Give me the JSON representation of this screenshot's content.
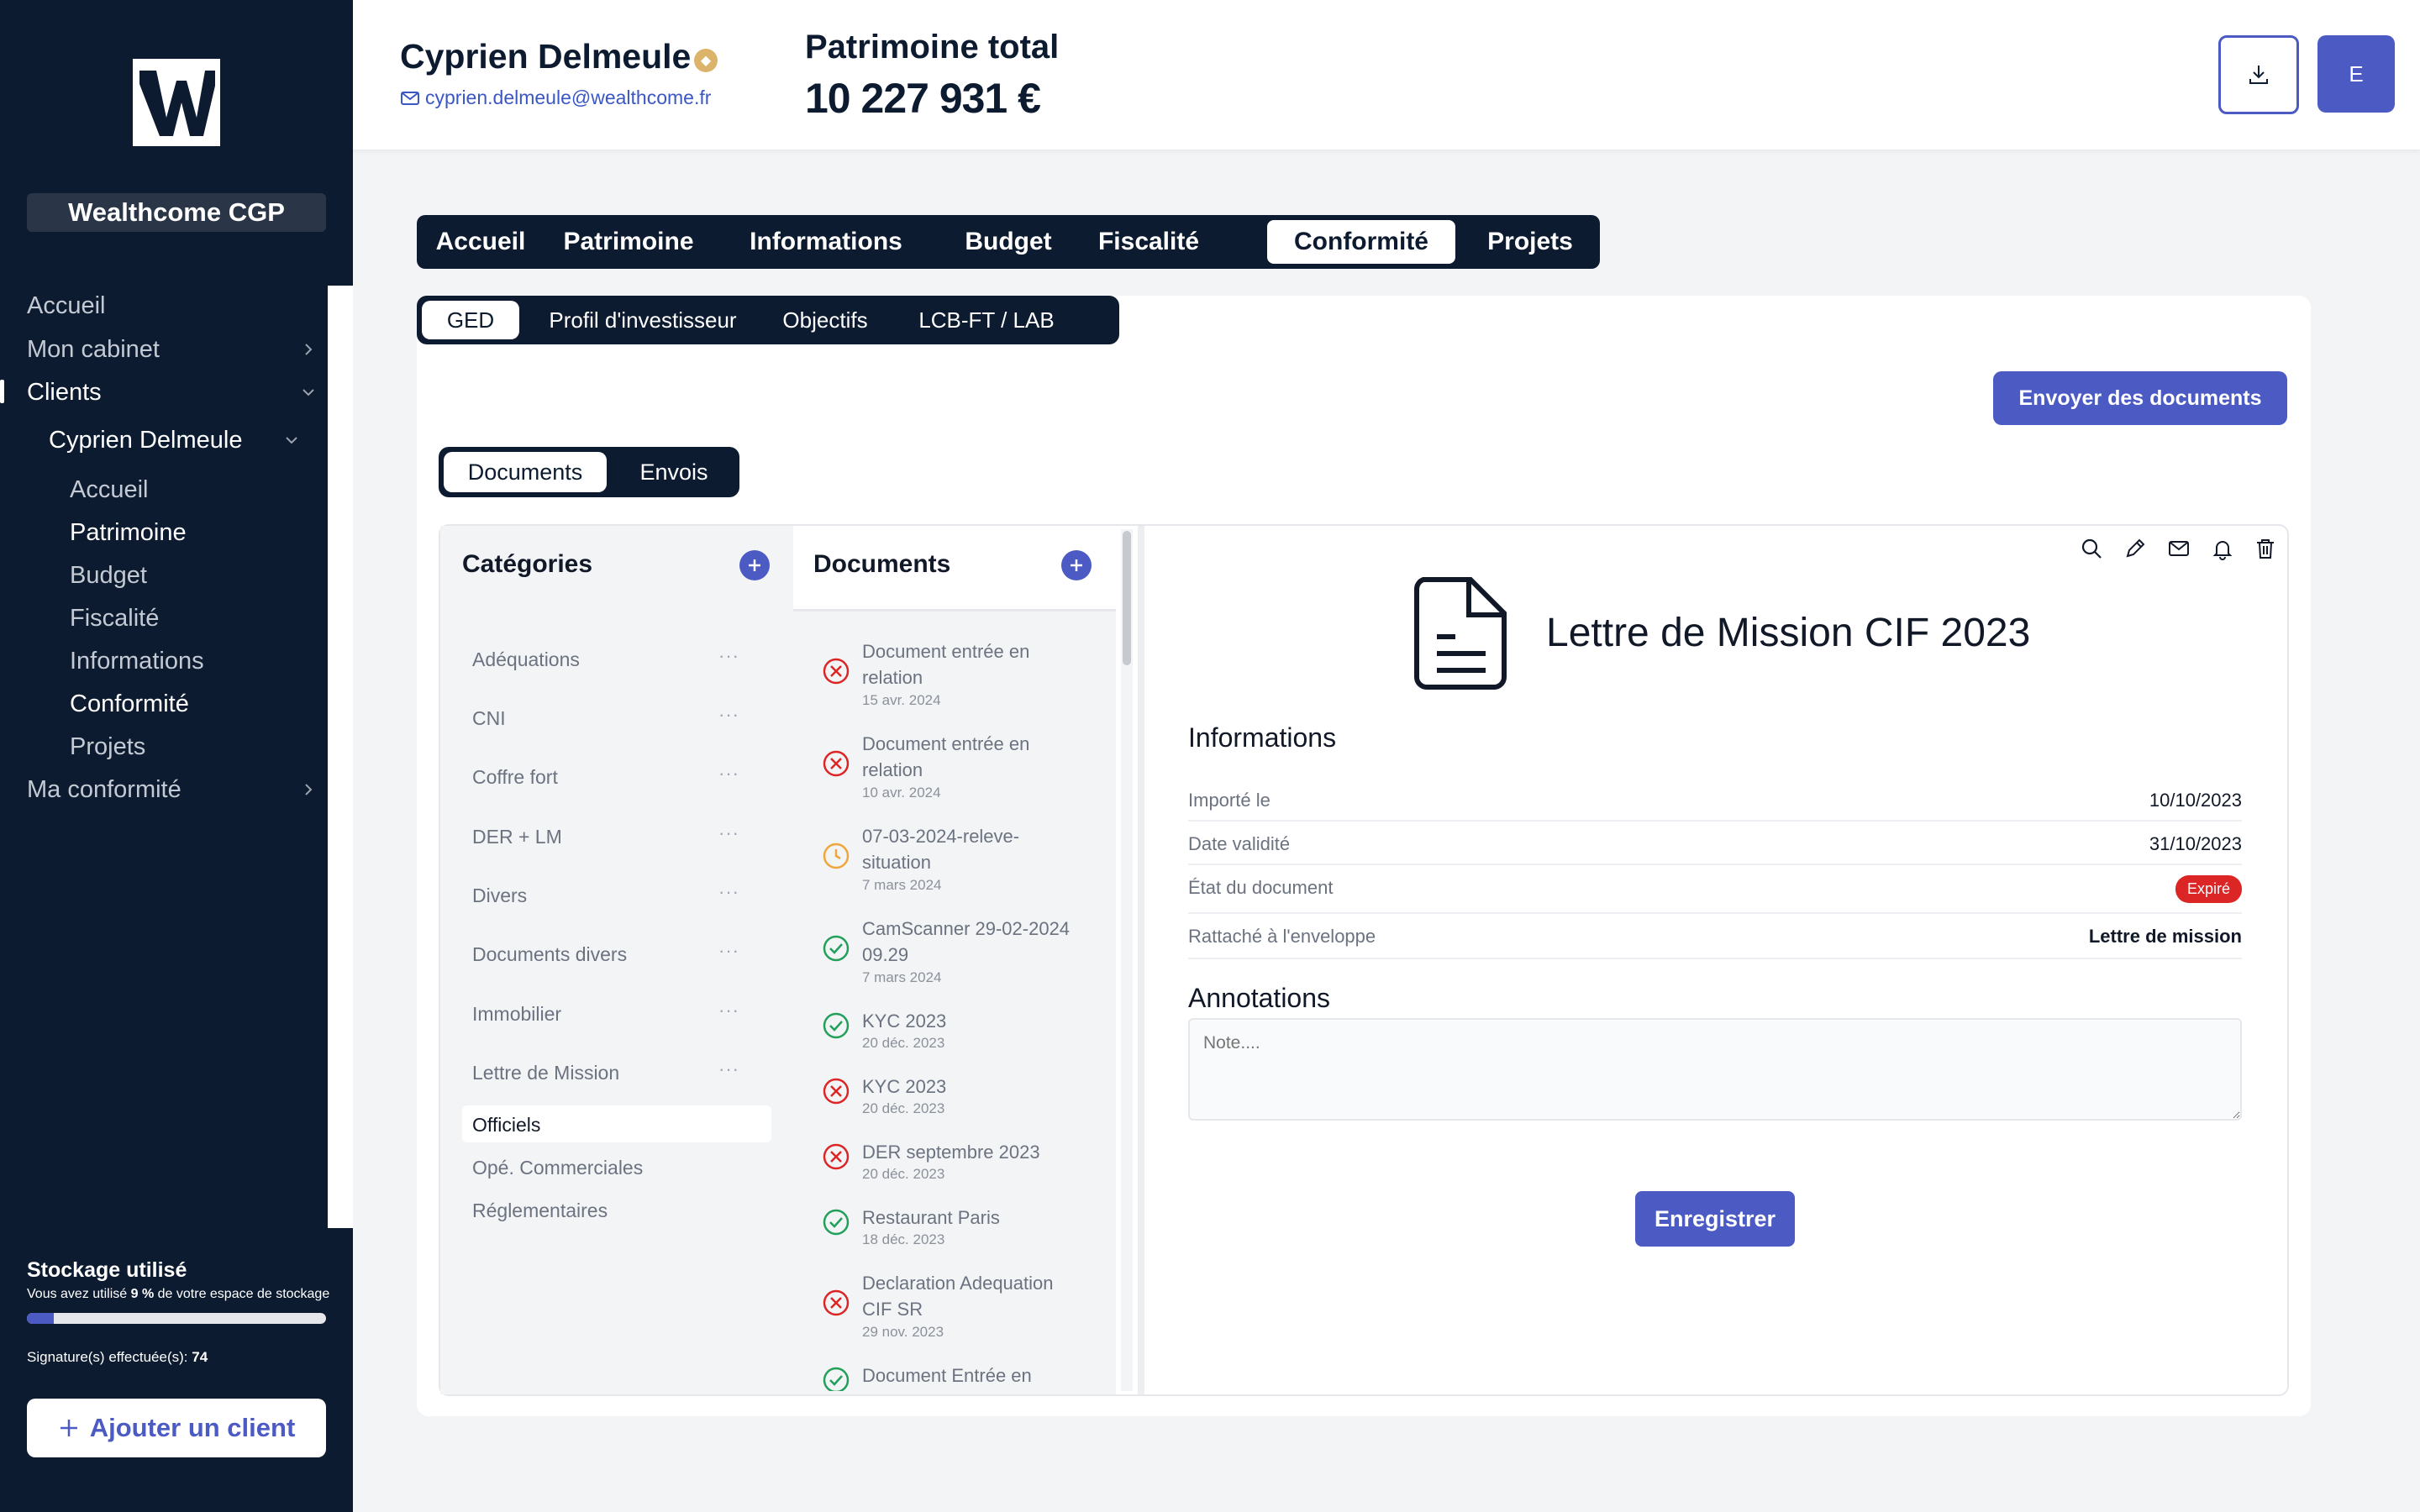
{
  "sidebar": {
    "firm_name": "Wealthcome CGP",
    "nav": [
      {
        "label": "Accueil"
      },
      {
        "label": "Mon cabinet"
      },
      {
        "label": "Clients"
      },
      {
        "label": "Cyprien Delmeule"
      },
      {
        "label": "Accueil"
      },
      {
        "label": "Patrimoine"
      },
      {
        "label": "Budget"
      },
      {
        "label": "Fiscalité"
      },
      {
        "label": "Informations"
      },
      {
        "label": "Conformité"
      },
      {
        "label": "Projets"
      },
      {
        "label": "Ma conformité"
      }
    ],
    "storage": {
      "title": "Stockage utilisé",
      "text_prefix": "Vous avez utilisé ",
      "percent": "9 %",
      "text_suffix": " de votre espace de stockage",
      "used_fraction": 0.09
    },
    "signatures": {
      "label": "Signature(s) effectuée(s):",
      "count": "74"
    },
    "add_client_label": "Ajouter un client"
  },
  "header": {
    "client_name": "Cyprien Delmeule",
    "client_email": "cyprien.delmeule@wealthcome.fr",
    "total_label": "Patrimoine total",
    "total_value": "10 227 931 €",
    "avatar_initial": "E"
  },
  "main_tabs": [
    "Accueil",
    "Patrimoine",
    "Informations",
    "Budget",
    "Fiscalité",
    "Conformité",
    "Projets"
  ],
  "active_main_tab": "Conformité",
  "sub_tabs": [
    "GED",
    "Profil d'investisseur",
    "Objectifs",
    "LCB-FT / LAB"
  ],
  "active_sub_tab": "GED",
  "send_documents_label": "Envoyer des documents",
  "doc_toggle": [
    "Documents",
    "Envois"
  ],
  "categories": {
    "title": "Catégories",
    "items": [
      "Adéquations",
      "CNI",
      "Coffre fort",
      "DER + LM",
      "Divers",
      "Documents divers",
      "Immobilier",
      "Lettre de Mission"
    ],
    "subitems": [
      "Officiels",
      "Opé. Commerciales",
      "Réglementaires"
    ],
    "dots": "···"
  },
  "documents": {
    "title": "Documents",
    "items": [
      {
        "name": "Document entrée en relation",
        "date": "15 avr. 2024",
        "status": "rejected"
      },
      {
        "name": "Document entrée en relation",
        "date": "10 avr. 2024",
        "status": "rejected"
      },
      {
        "name": "07-03-2024-releve-situation",
        "date": "7 mars 2024",
        "status": "pending"
      },
      {
        "name": "CamScanner 29-02-2024 09.29",
        "date": "7 mars 2024",
        "status": "valid"
      },
      {
        "name": "KYC 2023",
        "date": "20 déc. 2023",
        "status": "valid"
      },
      {
        "name": "KYC 2023",
        "date": "20 déc. 2023",
        "status": "rejected"
      },
      {
        "name": "DER septembre 2023",
        "date": "20 déc. 2023",
        "status": "rejected"
      },
      {
        "name": "Restaurant Paris",
        "date": "18 déc. 2023",
        "status": "valid"
      },
      {
        "name": "Declaration Adequation CIF SR",
        "date": "29 nov. 2023",
        "status": "rejected"
      },
      {
        "name": "Document Entrée en",
        "date": "",
        "status": "valid"
      }
    ]
  },
  "detail": {
    "title": "Lettre de Mission CIF 2023",
    "info_title": "Informations",
    "rows": [
      {
        "label": "Importé le",
        "value": "10/10/2023"
      },
      {
        "label": "Date validité",
        "value": "31/10/2023"
      },
      {
        "label": "État du document",
        "value": "Expiré"
      },
      {
        "label": "Rattaché à l'enveloppe",
        "value": "Lettre de mission"
      }
    ],
    "annotations_title": "Annotations",
    "note_placeholder": "Note....",
    "save_label": "Enregistrer"
  },
  "colors": {
    "navy": "#0c1b30",
    "accent": "#4c5bc4",
    "danger": "#dc2626",
    "success": "#22a05a",
    "pending": "#f0a63a"
  }
}
